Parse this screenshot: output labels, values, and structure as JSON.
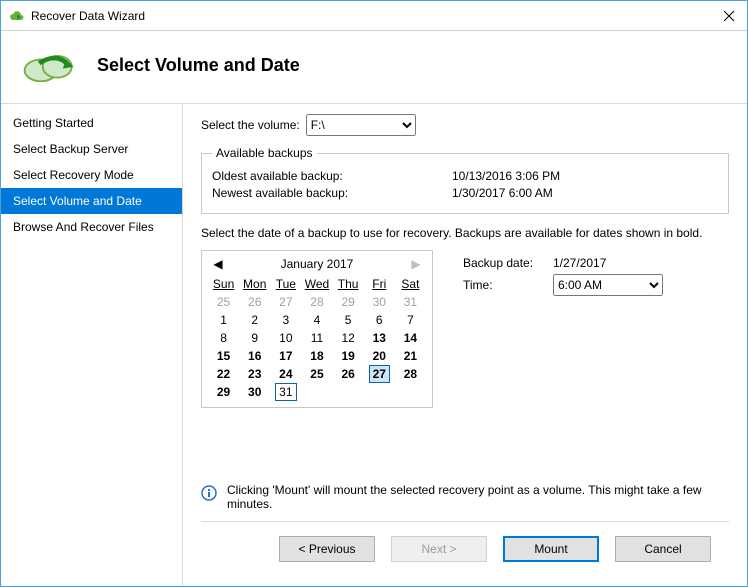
{
  "window": {
    "title": "Recover Data Wizard"
  },
  "header": {
    "title": "Select Volume and Date"
  },
  "sidebar": {
    "items": [
      {
        "label": "Getting Started"
      },
      {
        "label": "Select Backup Server"
      },
      {
        "label": "Select Recovery Mode"
      },
      {
        "label": "Select Volume and Date"
      },
      {
        "label": "Browse And Recover Files"
      }
    ],
    "activeIndex": 3
  },
  "main": {
    "volumeLabel": "Select the volume:",
    "volumeValue": "F:\\",
    "backupsLegend": "Available backups",
    "oldestLabel": "Oldest available backup:",
    "oldestValue": "10/13/2016 3:06 PM",
    "newestLabel": "Newest available backup:",
    "newestValue": "1/30/2017 6:00 AM",
    "instruction": "Select the date of a backup to use for recovery. Backups are available for dates shown in bold.",
    "backupDateLabel": "Backup date:",
    "backupDateValue": "1/27/2017",
    "timeLabel": "Time:",
    "timeValue": "6:00 AM",
    "noteText": "Clicking 'Mount' will mount the selected recovery point as a volume. This might take a few minutes."
  },
  "calendar": {
    "month": "January 2017",
    "dows": [
      "Sun",
      "Mon",
      "Tue",
      "Wed",
      "Thu",
      "Fri",
      "Sat"
    ],
    "weeks": [
      [
        {
          "n": 25,
          "gray": true
        },
        {
          "n": 26,
          "gray": true
        },
        {
          "n": 27,
          "gray": true
        },
        {
          "n": 28,
          "gray": true
        },
        {
          "n": 29,
          "gray": true
        },
        {
          "n": 30,
          "gray": true
        },
        {
          "n": 31,
          "gray": true
        }
      ],
      [
        {
          "n": 1
        },
        {
          "n": 2
        },
        {
          "n": 3
        },
        {
          "n": 4
        },
        {
          "n": 5
        },
        {
          "n": 6
        },
        {
          "n": 7
        }
      ],
      [
        {
          "n": 8
        },
        {
          "n": 9
        },
        {
          "n": 10
        },
        {
          "n": 11
        },
        {
          "n": 12
        },
        {
          "n": 13,
          "bold": true
        },
        {
          "n": 14,
          "bold": true
        }
      ],
      [
        {
          "n": 15,
          "bold": true
        },
        {
          "n": 16,
          "bold": true
        },
        {
          "n": 17,
          "bold": true
        },
        {
          "n": 18,
          "bold": true
        },
        {
          "n": 19,
          "bold": true
        },
        {
          "n": 20,
          "bold": true
        },
        {
          "n": 21,
          "bold": true
        }
      ],
      [
        {
          "n": 22,
          "bold": true
        },
        {
          "n": 23,
          "bold": true
        },
        {
          "n": 24,
          "bold": true
        },
        {
          "n": 25,
          "bold": true
        },
        {
          "n": 26,
          "bold": true
        },
        {
          "n": 27,
          "bold": true,
          "selected": true
        },
        {
          "n": 28,
          "bold": true
        }
      ],
      [
        {
          "n": 29,
          "bold": true
        },
        {
          "n": 30,
          "bold": true
        },
        {
          "n": 31,
          "today": true
        },
        {
          "n": ""
        },
        {
          "n": ""
        },
        {
          "n": ""
        },
        {
          "n": ""
        }
      ]
    ]
  },
  "footer": {
    "previous": "< Previous",
    "next": "Next >",
    "mount": "Mount",
    "cancel": "Cancel"
  }
}
